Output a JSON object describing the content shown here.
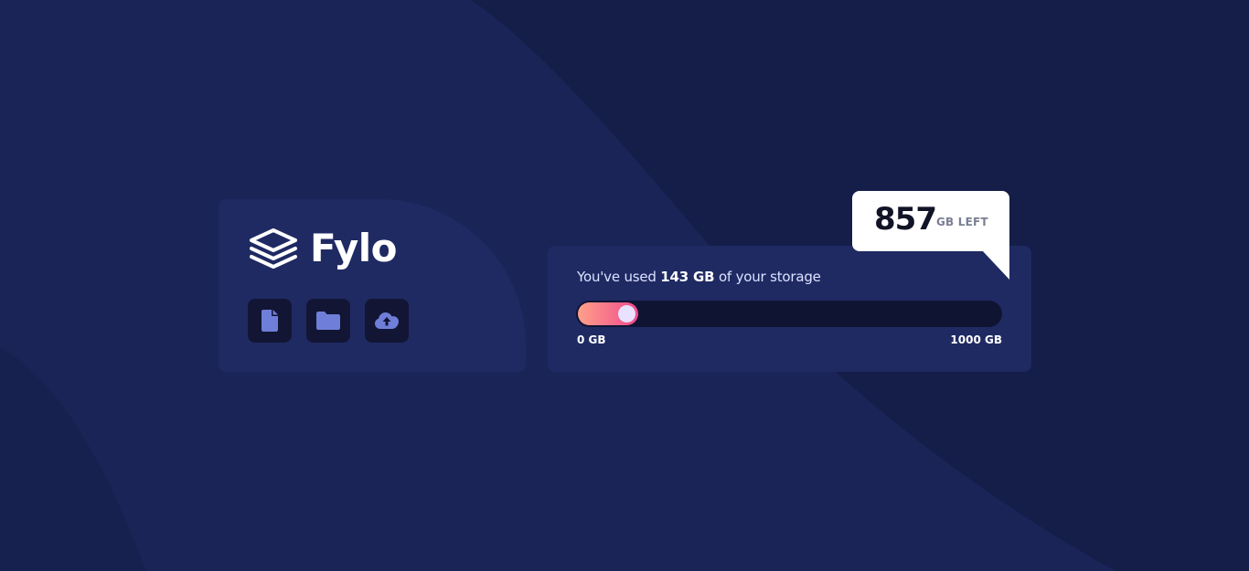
{
  "brand": {
    "name": "Fylo",
    "logo_icon": "stacked-layers-icon"
  },
  "actions": [
    {
      "icon": "document-icon"
    },
    {
      "icon": "folder-icon"
    },
    {
      "icon": "cloud-upload-icon"
    }
  ],
  "storage": {
    "prefix": "You've used ",
    "used": "143 GB",
    "suffix": " of your storage",
    "used_fraction": 0.143,
    "min_label": "0 GB",
    "max_label": "1000 GB",
    "remaining_value": "857",
    "remaining_unit": "GB LEFT"
  },
  "colors": {
    "page_background": "#1a2457",
    "card_background": "#1f2a63",
    "button_background": "#121634",
    "icon_accent": "#6f7fd9",
    "meter_gradient_start": "#ffa08a",
    "meter_gradient_end": "#f04a8c",
    "meter_knob": "#e8e2ff"
  }
}
